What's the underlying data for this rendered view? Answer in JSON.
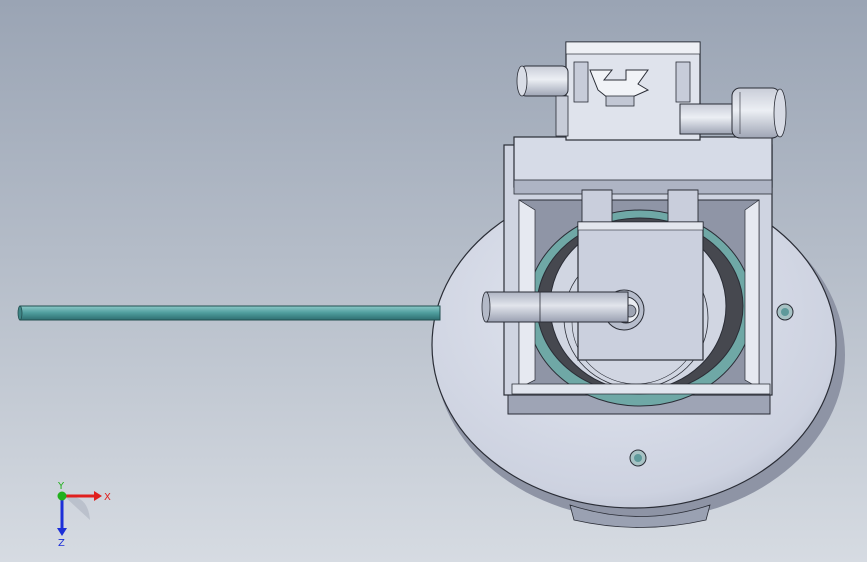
{
  "triad": {
    "x_label": "X",
    "y_label": "Y",
    "z_label": "Z",
    "x_color": "#e0201e",
    "y_color": "#22b01e",
    "z_color": "#1c2fd8"
  },
  "colors": {
    "part_face": "#d3d8e6",
    "part_shade": "#a9b0c2",
    "part_edge": "#2a2d36",
    "rod_color": "#5aa5a6",
    "seal_color": "#6fa8a6"
  },
  "icons": {
    "triad": "view-orientation-triad-icon",
    "model": "cad-assembly-model"
  }
}
